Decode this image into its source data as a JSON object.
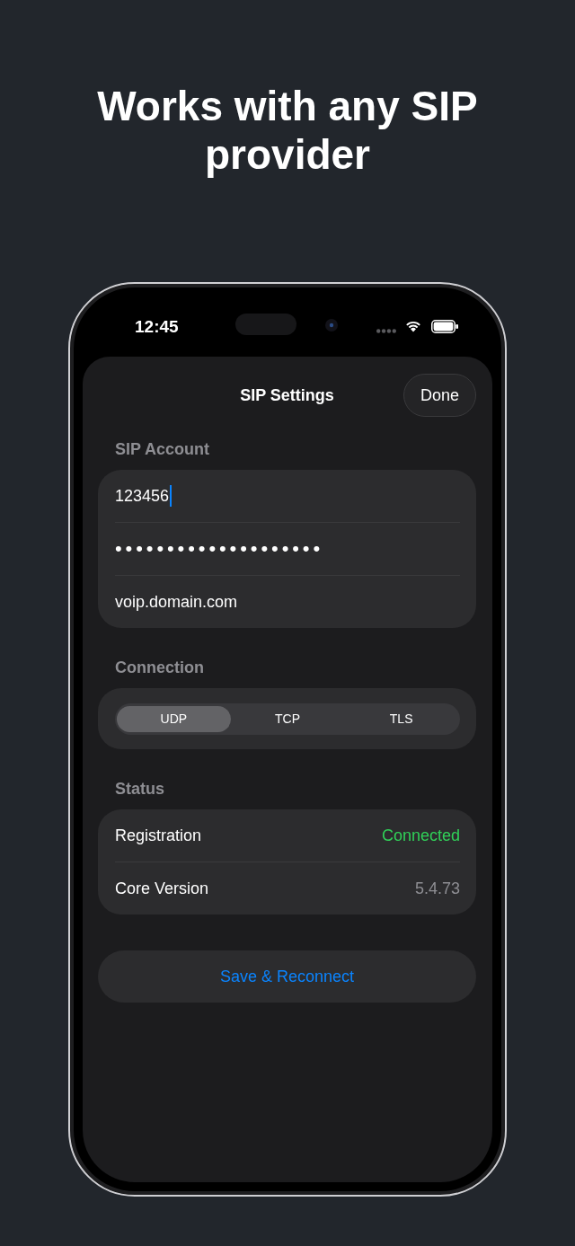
{
  "headline": "Works with any SIP provider",
  "status_bar": {
    "time": "12:45"
  },
  "sheet": {
    "title": "SIP Settings",
    "done_button": "Done",
    "sections": [
      {
        "kind": "fields",
        "header": "SIP Account",
        "fields": [
          {
            "kind": "text",
            "value": "123456",
            "focused": true
          },
          {
            "kind": "password",
            "value": "••••••••••••••••••••",
            "focused": false
          },
          {
            "kind": "text",
            "value": "voip.domain.com",
            "focused": false
          }
        ]
      },
      {
        "kind": "segmented",
        "header": "Connection",
        "options": [
          {
            "label": "UDP",
            "selected": true
          },
          {
            "label": "TCP",
            "selected": false
          },
          {
            "label": "TLS",
            "selected": false
          }
        ]
      },
      {
        "kind": "info",
        "header": "Status",
        "rows": [
          {
            "label": "Registration",
            "value": "Connected",
            "color": "#30d158"
          },
          {
            "label": "Core Version",
            "value": "5.4.73",
            "color": "#8e8e93"
          }
        ]
      }
    ],
    "action_button": "Save & Reconnect"
  }
}
